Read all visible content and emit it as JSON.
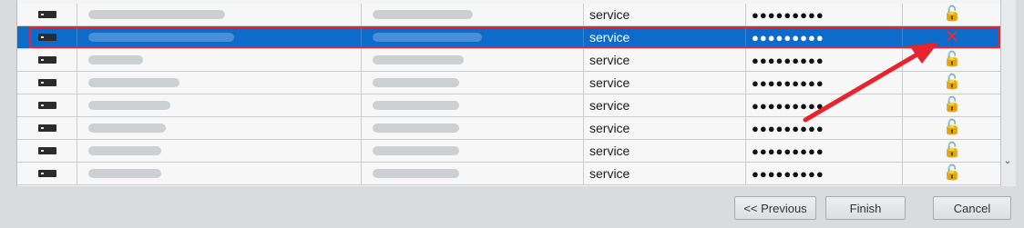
{
  "table": {
    "rows": [
      {
        "user": "service",
        "password": "●●●●●●●●●",
        "lock": "unlocked",
        "selected": false
      },
      {
        "user": "service",
        "password": "●●●●●●●●●",
        "lock": "failed",
        "selected": true
      },
      {
        "user": "service",
        "password": "●●●●●●●●●",
        "lock": "unlocked",
        "selected": false
      },
      {
        "user": "service",
        "password": "●●●●●●●●●",
        "lock": "unlocked",
        "selected": false
      },
      {
        "user": "service",
        "password": "●●●●●●●●●",
        "lock": "unlocked",
        "selected": false
      },
      {
        "user": "service",
        "password": "●●●●●●●●●",
        "lock": "unlocked",
        "selected": false
      },
      {
        "user": "service",
        "password": "●●●●●●●●●",
        "lock": "unlocked",
        "selected": false
      },
      {
        "user": "service",
        "password": "●●●●●●●●●",
        "lock": "unlocked",
        "selected": false
      }
    ]
  },
  "icons": {
    "device": "device-icon",
    "unlocked": "unlocked-padlock-icon",
    "failed": "x-icon"
  },
  "colors": {
    "selection": "#0d6cc9",
    "annotation": "#e8232e",
    "lock_green": "#1aa34a"
  },
  "buttons": {
    "previous": "<< Previous",
    "finish": "Finish",
    "cancel": "Cancel"
  }
}
